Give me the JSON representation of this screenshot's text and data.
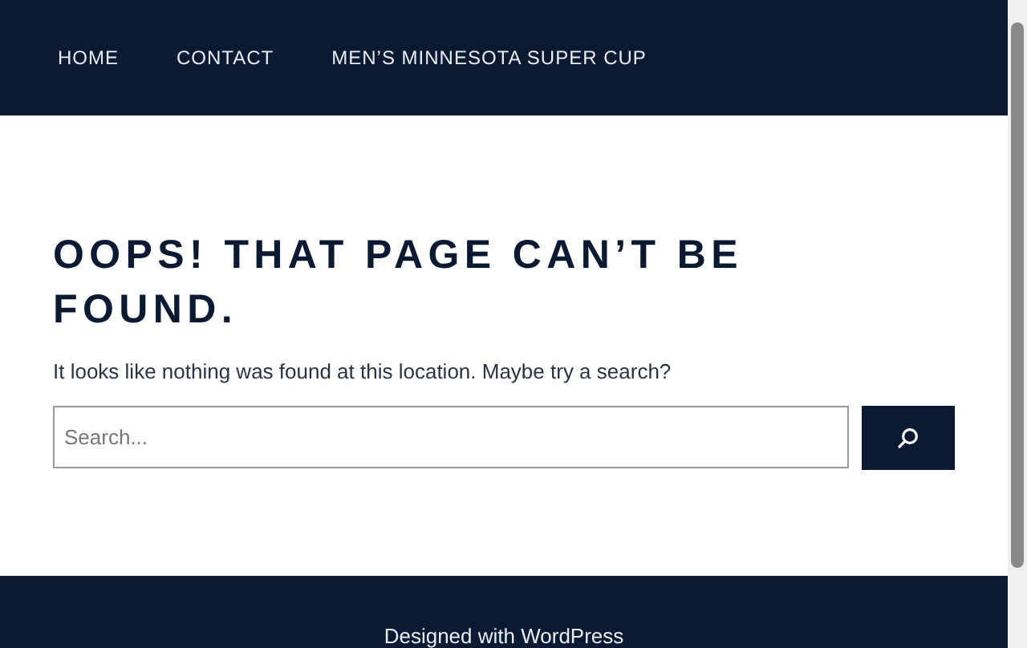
{
  "nav": {
    "items": [
      {
        "label": "HOME"
      },
      {
        "label": "CONTACT"
      },
      {
        "label": "MEN’S MINNESOTA SUPER CUP"
      }
    ]
  },
  "main": {
    "title": "OOPS! THAT PAGE CAN’T BE FOUND.",
    "message": "It looks like nothing was found at this location. Maybe try a search?",
    "search": {
      "placeholder": "Search..."
    }
  },
  "footer": {
    "text": "Designed with WordPress"
  }
}
